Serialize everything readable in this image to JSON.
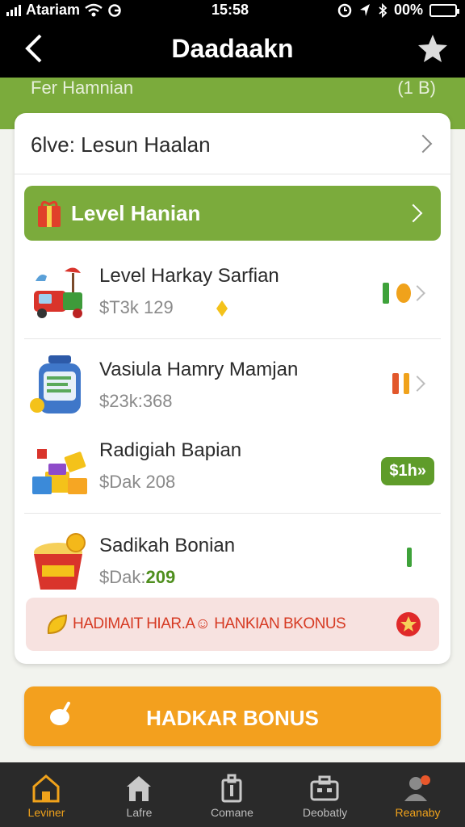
{
  "status_bar": {
    "carrier": "Atariam",
    "time": "15:58",
    "battery": "00%"
  },
  "header": {
    "title": "Daadaakn"
  },
  "green_band": {
    "left_text": "Fer Hamnian",
    "right_text": "(1 B)"
  },
  "card": {
    "header_label": "6lve: Lesun Haalan",
    "level_bar": {
      "label": "Level Hanian"
    },
    "items": [
      {
        "name": "Level Harkay Sarfian",
        "price": "$T3k 129",
        "icon": "toy-truck-icon"
      },
      {
        "name": "Vasiula Hamry Mamjan",
        "price": "$23k:368",
        "icon": "jar-icon"
      },
      {
        "name": "Radigiah Bapian",
        "price": "$Dak 208",
        "icon": "gift-boxes-icon",
        "button": "$1h»"
      },
      {
        "name": "Sadikah Bonian",
        "price_prefix": "$Dak:",
        "price_value": "209",
        "icon": "popcorn-icon"
      }
    ],
    "bonus_banner": {
      "text": "HADIMAIT HIAR.A☺ HANKIAN BKONUS"
    }
  },
  "main_button": {
    "label": "HADKAR BONUS"
  },
  "tab_bar": {
    "tabs": [
      {
        "label": "Leviner",
        "icon": "home-icon",
        "active": true
      },
      {
        "label": "Lafre",
        "icon": "store-icon",
        "active": false
      },
      {
        "label": "Comane",
        "icon": "bag-icon",
        "active": false
      },
      {
        "label": "Deobatly",
        "icon": "briefcase-icon",
        "active": false
      },
      {
        "label": "Reanaby",
        "icon": "profile-icon",
        "active": true
      }
    ]
  },
  "colors": {
    "accent_green": "#7bab3c",
    "accent_orange": "#f3a01e",
    "banner_red": "#d63a23",
    "tab_active": "#f0a21b"
  }
}
